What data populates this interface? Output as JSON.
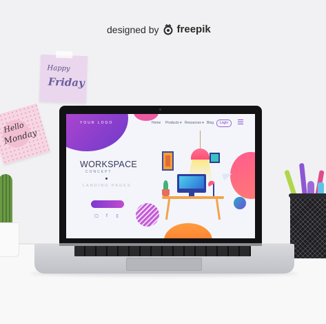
{
  "credit": {
    "prefix": "designed by",
    "brand": "freepik"
  },
  "notes": {
    "friday_line1": "Happy",
    "friday_line2": "Friday",
    "monday_line1": "Hello",
    "monday_line2": "Monday"
  },
  "website": {
    "logo": "YOUR LOGO",
    "nav": {
      "home": "Home",
      "products": "Products ▾",
      "resources": "Resources ▾",
      "blog": "Blog",
      "login": "Login"
    },
    "hero": {
      "title": "WORKSPACE",
      "subtitle": "CONCEPT",
      "tagline": "LANDING PAGES"
    },
    "social": [
      "▢",
      "f",
      "▯"
    ]
  },
  "colors": {
    "accent_purple": "#7c39d0",
    "accent_pink": "#ff5c8e",
    "accent_orange": "#ff9b3d",
    "screen_bezel": "#121214"
  },
  "icons": {
    "credit_logo": "freepik-logo-icon",
    "menu": "hamburger-menu-icon"
  }
}
